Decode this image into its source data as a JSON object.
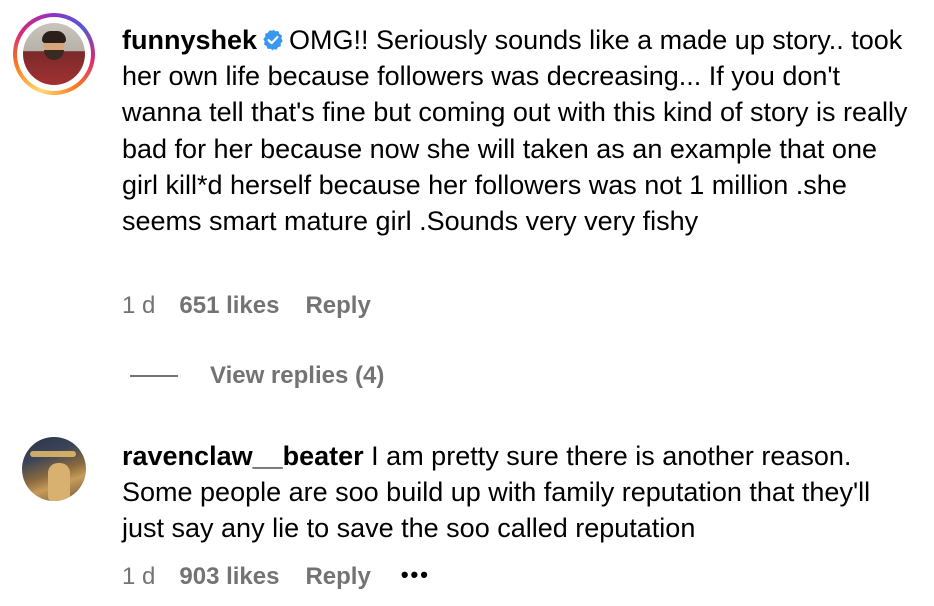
{
  "comments": [
    {
      "username": "funnyshek",
      "verified": true,
      "text": "OMG!! Seriously sounds like a made up story.. took her own life because followers was decreasing... If you don't wanna tell that's fine but coming out with this kind of story is really bad for her because now she will taken as an example that one girl kill*d herself because her followers was not 1 million .she seems smart mature girl .Sounds very very fishy",
      "time": "1 d",
      "likes": "651 likes",
      "reply_label": "Reply",
      "view_replies": "View replies (4)"
    },
    {
      "username": "ravenclaw__beater",
      "verified": false,
      "text": "I am pretty sure there is another reason. Some people are soo build up with family reputation that they'll just say any lie to save the soo called reputation",
      "time": "1 d",
      "likes": "903 likes",
      "reply_label": "Reply",
      "more": "•••"
    }
  ],
  "colors": {
    "verified_badge": "#3897f0",
    "meta_text": "#737373"
  },
  "icons": {
    "verified": "verified-badge-icon",
    "more": "more-options-icon"
  }
}
